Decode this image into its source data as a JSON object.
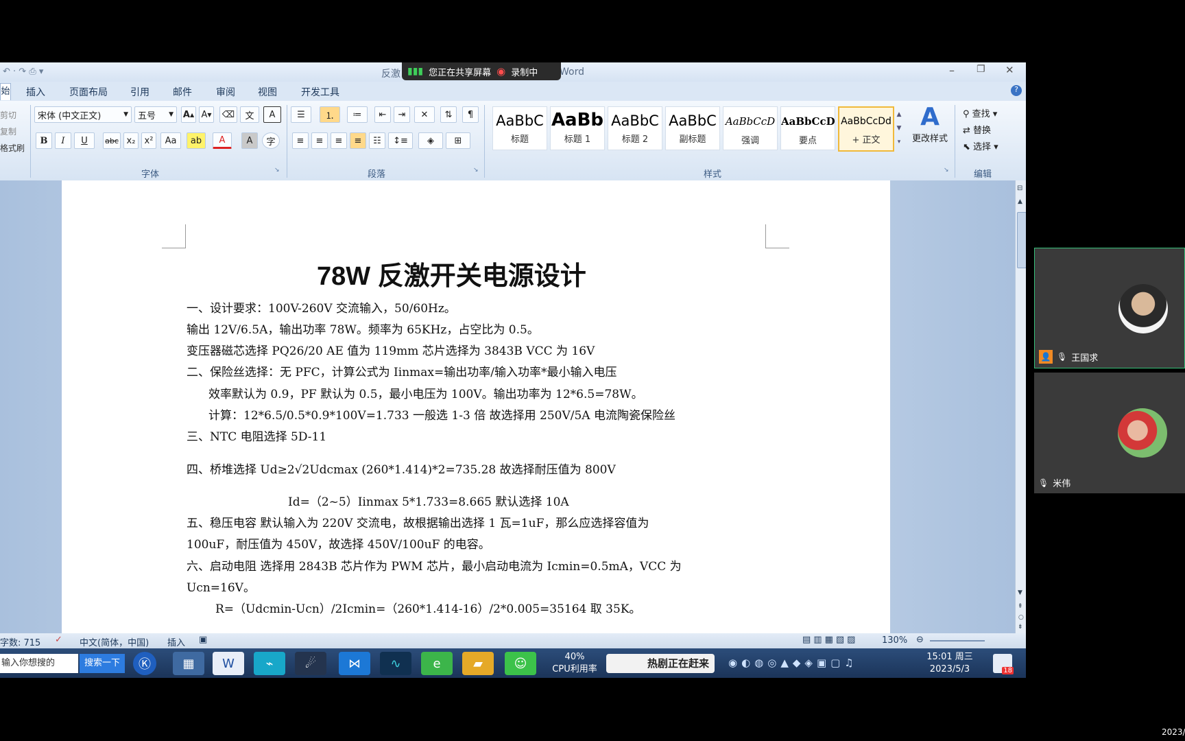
{
  "window": {
    "title_left": "反激",
    "title_right": "Word",
    "share_status": "您正在共享屏幕",
    "recording": "录制中",
    "minimize": "–",
    "restore": "❐",
    "close": "✕"
  },
  "tabs": [
    "始",
    "插入",
    "页面布局",
    "引用",
    "邮件",
    "审阅",
    "视图",
    "开发工具"
  ],
  "ribbon": {
    "clipboard": [
      "剪切",
      "复制",
      "格式刷"
    ],
    "font_name": "宋体 (中文正文)",
    "font_size": "五号",
    "group_font": "字体",
    "group_paragraph": "段落",
    "group_styles": "样式",
    "group_edit": "编辑",
    "styles": [
      {
        "sample": "AaBbC",
        "name": "标题"
      },
      {
        "sample": "AaBb",
        "name": "标题 1"
      },
      {
        "sample": "AaBbC",
        "name": "标题 2"
      },
      {
        "sample": "AaBbC",
        "name": "副标题"
      },
      {
        "sample": "AaBbCcD",
        "name": "强调"
      },
      {
        "sample": "AaBbCcD",
        "name": "要点"
      },
      {
        "sample": "AaBbCcDd",
        "name": "+ 正文"
      }
    ],
    "change_styles": "更改样式",
    "find": "查找",
    "replace": "替换",
    "select": "选择"
  },
  "document": {
    "title": "78W 反激开关电源设计",
    "lines": [
      "一、设计要求：100V-260V 交流输入，50/60Hz。",
      "输出 12V/6.5A，输出功率 78W。频率为 65KHz，占空比为 0.5。",
      "变压器磁芯选择 PQ26/20   AE 值为 119mm   芯片选择为 3843B   VCC 为 16V",
      "二、保险丝选择：无 PFC，计算公式为 Iinmax=输出功率/输入功率*最小输入电压",
      "效率默认为 0.9，PF 默认为 0.5，最小电压为 100V。输出功率为 12*6.5=78W。",
      "计算：12*6.5/0.5*0.9*100V=1.733   一般选 1-3 倍  故选择用 250V/5A  电流陶瓷保险丝",
      "三、NTC 电阻选择 5D-11",
      "四、桥堆选择   Ud≥2√2Udcmax   (260*1.414)*2=735.28   故选择耐压值为 800V",
      "Id=（2~5）Iinmax   5*1.733=8.665  默认选择 10A",
      "五、稳压电容   默认输入为 220V 交流电，故根据输出选择 1 瓦=1uF，那么应选择容值为",
      "100uF，耐压值为 450V，故选择 450V/100uF 的电容。",
      "六、启动电阻 选择用 2843B 芯片作为 PWM 芯片，最小启动电流为 Icmin=0.5mA，VCC 为",
      "Ucn=16V。",
      "R=（Udcmin-Ucn）/2Icmin=（260*1.414-16）/2*0.005=35164   取 35K。"
    ]
  },
  "statusbar": {
    "word_count": "字数: 715",
    "language": "中文(简体，中国)",
    "mode": "插入",
    "zoom": "130%"
  },
  "taskbar": {
    "search_placeholder": "输入你想搜的",
    "search_button": "搜索一下",
    "cpu_percent": "40%",
    "cpu_label": "CPU利用率",
    "banner": "热剧正在赶来",
    "time": "15:01 周三",
    "date": "2023/5/3",
    "badge": "18"
  },
  "participants": [
    {
      "name": "王国求"
    },
    {
      "name": "米伟"
    }
  ],
  "corner_date": "2023/"
}
